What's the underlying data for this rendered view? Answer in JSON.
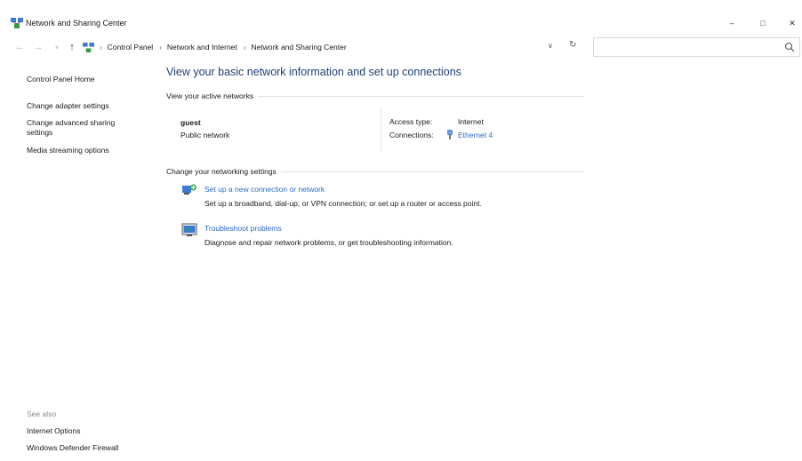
{
  "window": {
    "title": "Network and Sharing Center",
    "controls": {
      "minimize": "–",
      "maximize": "□",
      "close": "✕"
    }
  },
  "address_bar": {
    "nav": {
      "back": "←",
      "forward": "→",
      "recent": "∨",
      "up": "↑"
    },
    "breadcrumbs": [
      "Control Panel",
      "Network and Internet",
      "Network and Sharing Center"
    ],
    "separator": "›",
    "dropdown": "∨",
    "refresh": "↻",
    "search_value": "",
    "search_icon": "search-icon"
  },
  "left_pane": {
    "home": "Control Panel Home",
    "links": [
      "Change adapter settings",
      "Change advanced sharing settings",
      "Media streaming options"
    ],
    "see_also_label": "See also",
    "see_also": [
      "Internet Options",
      "Windows Defender Firewall"
    ]
  },
  "main": {
    "title": "View your basic network information and set up connections",
    "active_networks_header": "View your active networks",
    "network": {
      "name": "guest",
      "category": "Public network",
      "access_type_label": "Access type:",
      "access_type_value": "Internet",
      "connections_label": "Connections:",
      "connections_value": "Ethernet 4"
    },
    "change_settings_header": "Change your networking settings",
    "tasks": [
      {
        "icon": "new-connection-icon",
        "link": "Set up a new connection or network",
        "description": "Set up a broadband, dial-up, or VPN connection; or set up a router or access point."
      },
      {
        "icon": "troubleshoot-icon",
        "link": "Troubleshoot problems",
        "description": "Diagnose and repair network problems, or get troubleshooting information."
      }
    ]
  },
  "colors": {
    "link": "#2b6ac5",
    "title": "#1e3f7a",
    "muted": "#8a8a8a"
  }
}
